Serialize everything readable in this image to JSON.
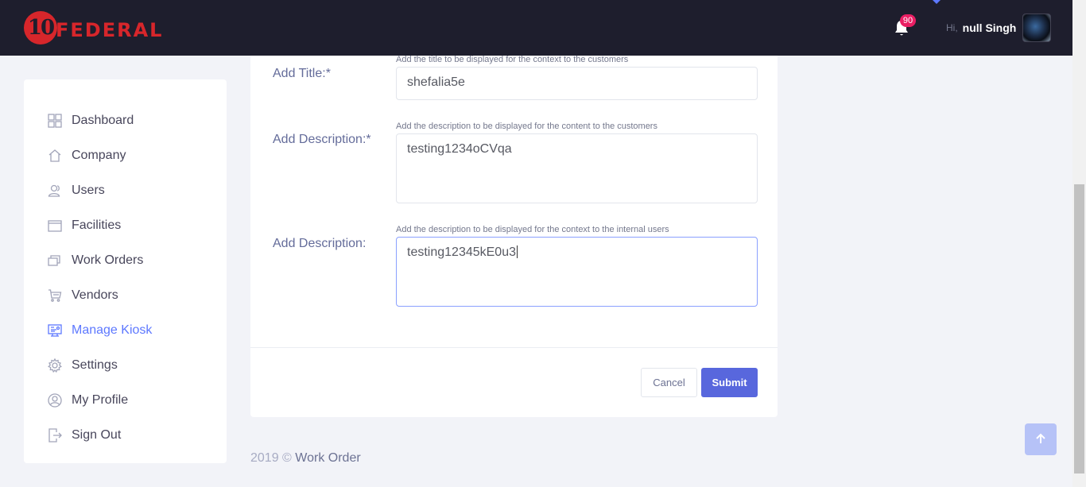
{
  "header": {
    "logo_number": "10",
    "logo_text": "FEDERAL",
    "notification_count": "90",
    "greeting": "Hi,",
    "user_name": "null Singh"
  },
  "sidebar": {
    "items": [
      {
        "label": "Dashboard",
        "icon": "dashboard-icon"
      },
      {
        "label": "Company",
        "icon": "home-icon"
      },
      {
        "label": "Users",
        "icon": "users-icon"
      },
      {
        "label": "Facilities",
        "icon": "facilities-icon"
      },
      {
        "label": "Work Orders",
        "icon": "work-orders-icon"
      },
      {
        "label": "Vendors",
        "icon": "cart-icon"
      },
      {
        "label": "Manage Kiosk",
        "icon": "kiosk-icon",
        "active": true
      },
      {
        "label": "Settings",
        "icon": "gear-icon"
      },
      {
        "label": "My Profile",
        "icon": "profile-icon"
      },
      {
        "label": "Sign Out",
        "icon": "sign-out-icon"
      }
    ]
  },
  "form": {
    "title": {
      "label": "Add Title:*",
      "hint": "Add the title to be displayed for the context to the customers",
      "value": "shefalia5e"
    },
    "description_customer": {
      "label": "Add Description:*",
      "hint": "Add the description to be displayed for the content to the customers",
      "value": "testing1234oCVqa"
    },
    "description_internal": {
      "label": "Add Description:",
      "hint": "Add the description to be displayed for the context to the internal users",
      "value": "testing12345kE0u3"
    },
    "cancel_label": "Cancel",
    "submit_label": "Submit"
  },
  "footer": {
    "year": "2019 ©",
    "brand": "Work Order"
  },
  "colors": {
    "header_bg": "#1e1e2d",
    "accent": "#5d78ff",
    "submit": "#5867dd",
    "logo_red": "#d7262b",
    "badge": "#e91e63"
  }
}
